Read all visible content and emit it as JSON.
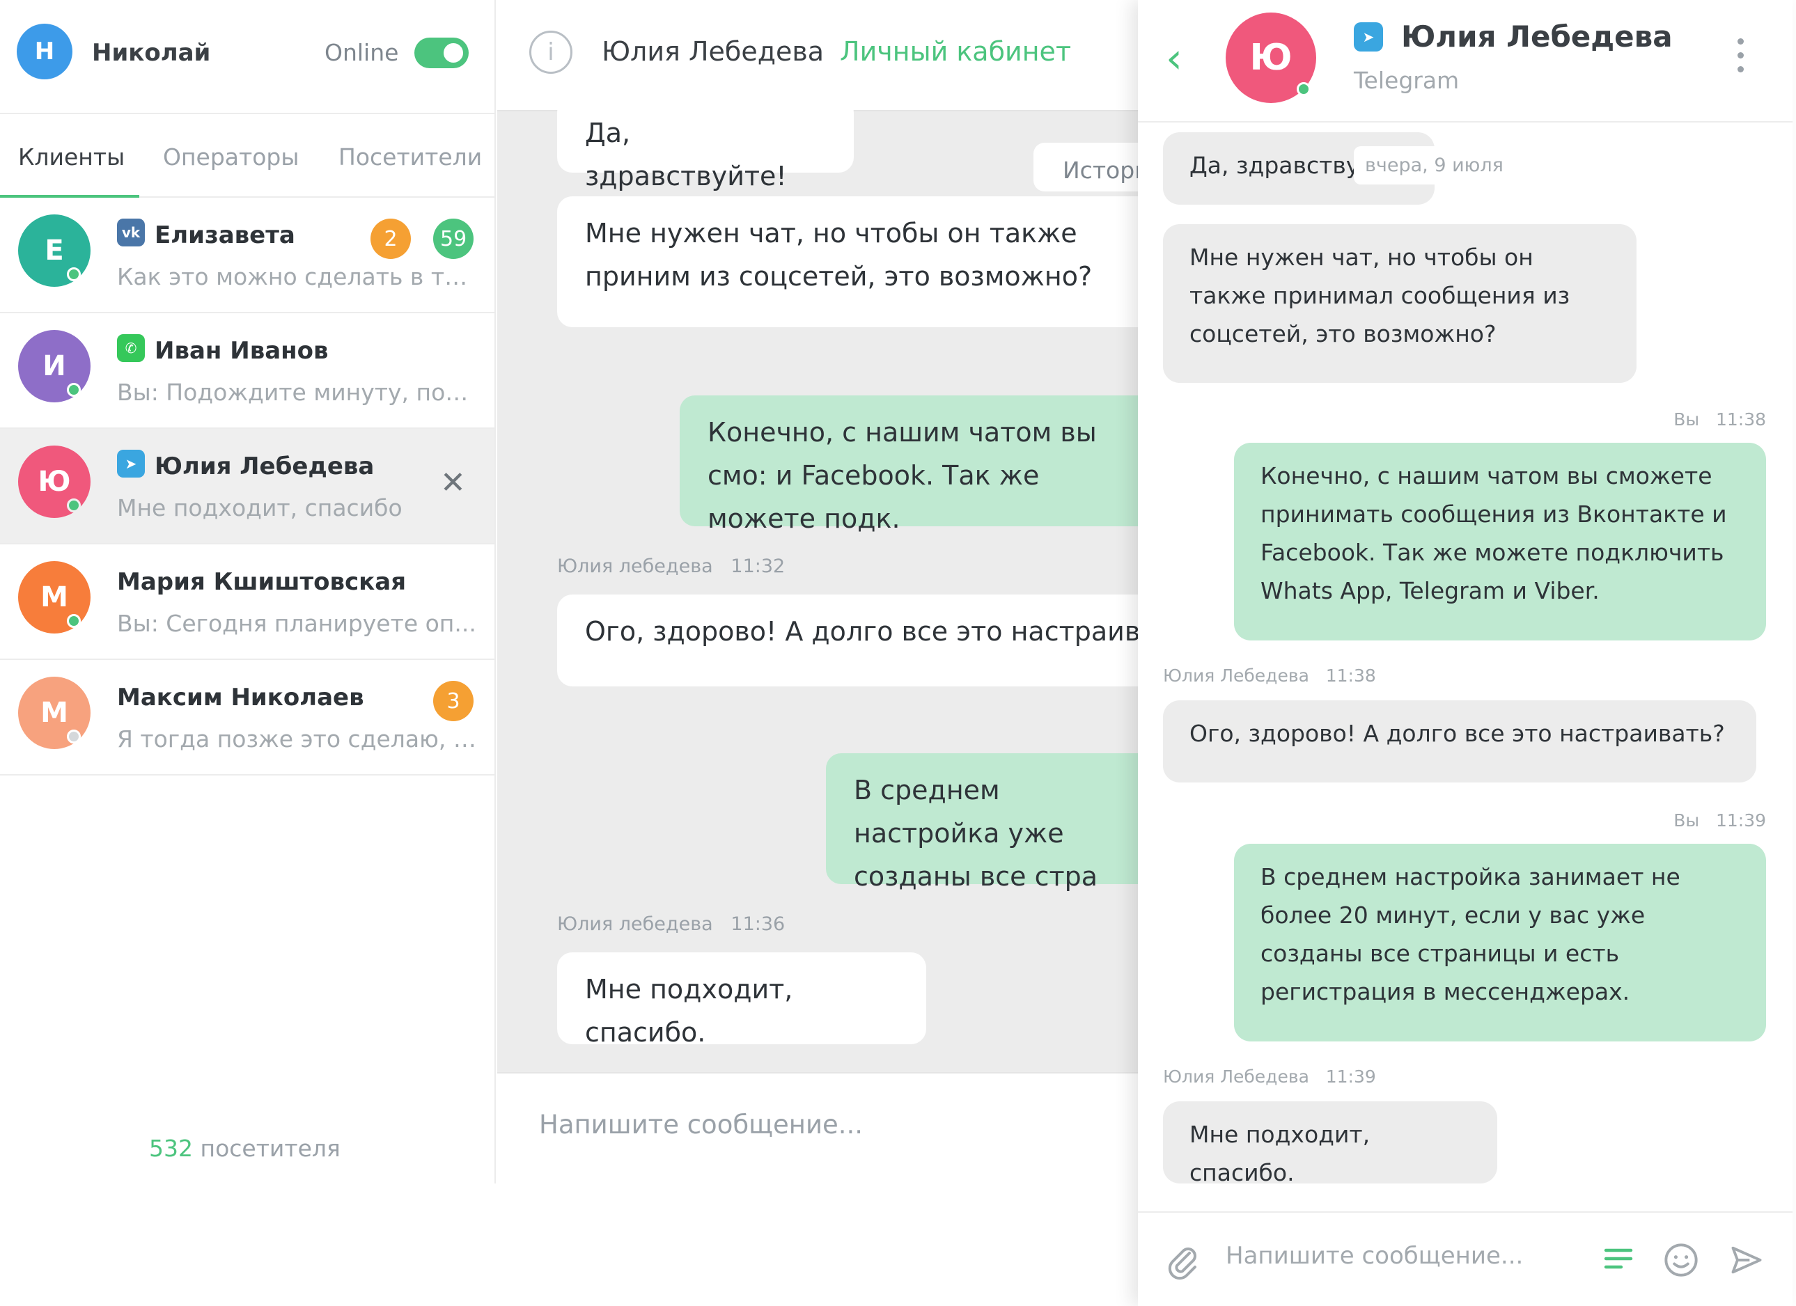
{
  "colors": {
    "accent": "#4cc47e",
    "badge_orange": "#f5a033",
    "badge_green": "#4cc47e",
    "out_bubble": "#bfe9d1"
  },
  "left": {
    "operator": {
      "initial": "Н",
      "name": "Николай",
      "status_label": "Online",
      "status_on": true
    },
    "tabs": [
      {
        "label": "Клиенты",
        "active": true
      },
      {
        "label": "Операторы",
        "active": false
      },
      {
        "label": "Посетители",
        "active": false
      }
    ],
    "clients": [
      {
        "initial": "Е",
        "name": "Елизавета",
        "network": "vk-icon",
        "preview": "Как это можно сделать в так...",
        "badges": [
          "2",
          "59"
        ],
        "online": true
      },
      {
        "initial": "И",
        "name": "Иван Иванов",
        "network": "whatsapp-icon",
        "preview": "Вы: Подождите минуту, пож...",
        "badges": [],
        "online": true
      },
      {
        "initial": "Ю",
        "name": "Юлия Лебедева",
        "network": "telegram-icon",
        "preview": "Мне подходит, спасибо",
        "badges": [],
        "online": true,
        "selected": true,
        "close": "✕"
      },
      {
        "initial": "М",
        "name": "Мария Кшиштовская",
        "network": "",
        "preview": "Вы: Сегодня планируете оп...",
        "badges": [],
        "online": true
      },
      {
        "initial": "М",
        "name": "Максим Николаев",
        "network": "",
        "preview": "Я тогда позже это сделаю, с...",
        "badges": [
          "3"
        ],
        "online": false
      }
    ],
    "visitors_count": "532",
    "visitors_label": "посетителя"
  },
  "middle": {
    "info_icon": "i",
    "contact": "Юлия Лебедева",
    "cabinet_link": "Личный кабинет",
    "history_chip": "Истори",
    "messages": [
      {
        "dir": "in",
        "text": "Да, здравствуйте!"
      },
      {
        "dir": "in",
        "text": "Мне нужен чат, но чтобы он также приним из соцсетей, это возможно?"
      },
      {
        "dir": "out",
        "text": "Конечно, с нашим чатом вы смо: и Facebook. Так же можете подк."
      },
      {
        "dir": "in",
        "author": "Юлия лебедева",
        "time": "11:32",
        "text": "Ого, здорово! А долго все это настраиват"
      },
      {
        "dir": "out",
        "text": "В среднем настройка уже созданы все стра"
      },
      {
        "dir": "in",
        "author": "Юлия лебедева",
        "time": "11:36",
        "text": "Мне подходит, спасибо."
      }
    ],
    "input_placeholder": "Напишите сообщение..."
  },
  "widget": {
    "back_icon": "chevron-left-icon",
    "avatar_initial": "Ю",
    "contact": "Юлия Лебедева",
    "network": "Telegram",
    "date_chip": "вчера, 9 июля",
    "messages": [
      {
        "dir": "in",
        "text": "Да, здравствуй"
      },
      {
        "dir": "in",
        "text": "Мне нужен чат, но чтобы он также принимал сообщения из соцсетей, это возможно?"
      },
      {
        "dir": "out",
        "author": "Вы",
        "time": "11:38",
        "text": "Конечно, с нашим чатом вы сможете принимать сообщения из Вконтакте и Facebook. Так же можете подключить Whats App, Telegram и Viber."
      },
      {
        "dir": "in",
        "author": "Юлия Лебедева",
        "time": "11:38",
        "text": "Ого, здорово! А долго все это настраивать?"
      },
      {
        "dir": "out",
        "author": "Вы",
        "time": "11:39",
        "text": "В среднем настройка занимает не более 20 минут, если у вас уже созданы все страницы и есть регистрация в мессенджерах."
      },
      {
        "dir": "in",
        "author": "Юлия Лебедева",
        "time": "11:39",
        "text": "Мне подходит, спасибо."
      }
    ],
    "input_placeholder": "Напишите сообщение..."
  }
}
